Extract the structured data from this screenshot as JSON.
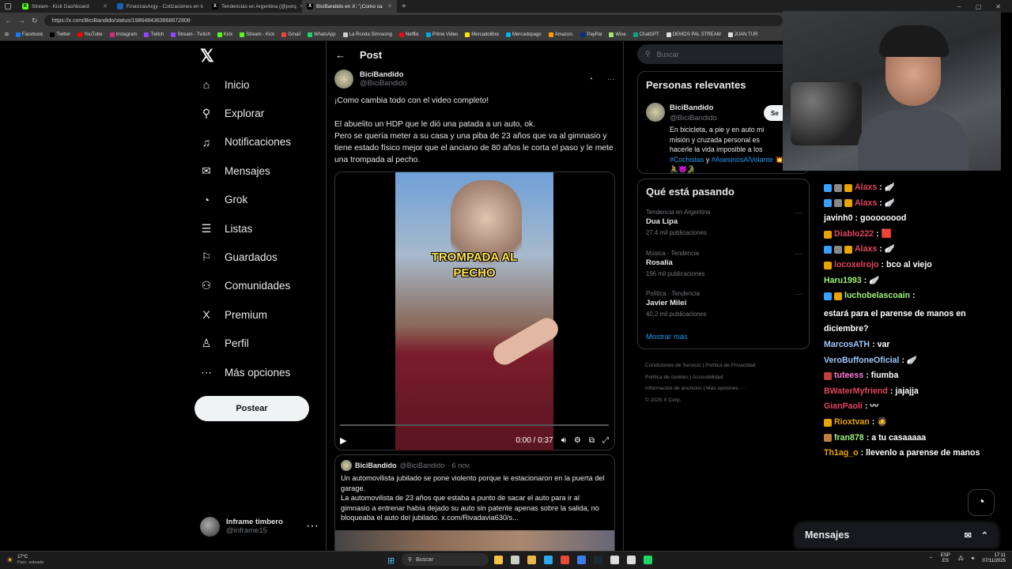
{
  "browser": {
    "tabs": [
      {
        "label": "Stream - Kick Dashboard",
        "icon_color": "#53fc18",
        "icon_text": "K"
      },
      {
        "label": "FinanzasArgy - Cotizaciones en ti",
        "icon_color": "#1a5fb4",
        "icon_text": ""
      },
      {
        "label": "Tendencias en Argentina (@porq",
        "icon_color": "#000000",
        "icon_text": "X"
      },
      {
        "label": "BiciBandido en X: \"¡Como ca",
        "icon_color": "#000000",
        "icon_text": "X"
      }
    ],
    "url": "https://x.com/BiciBandido/status/1986484363668672808",
    "bookmarks": [
      "Facebook",
      "Twitter",
      "YouTube",
      "Instagram",
      "Twitch",
      "Stream - Twitch",
      "Kick",
      "Stream - Kick",
      "Gmail",
      "WhatsApp",
      "La Ronda Simracing",
      "Netflix",
      "Prime Video",
      "Mercadolibre",
      "Mercadopago",
      "Amazon.",
      "PayPal",
      "Wise",
      "ChatGPT",
      "DEMOS PAL STREAM",
      "JUAN TUR"
    ]
  },
  "nav": {
    "items": [
      {
        "label": "Inicio",
        "icon": "home-icon",
        "glyph": "⌂"
      },
      {
        "label": "Explorar",
        "icon": "search-icon",
        "glyph": "⚲"
      },
      {
        "label": "Notificaciones",
        "icon": "bell-icon",
        "glyph": "♫"
      },
      {
        "label": "Mensajes",
        "icon": "mail-icon",
        "glyph": "✉"
      },
      {
        "label": "Grok",
        "icon": "grok-icon",
        "glyph": "◔"
      },
      {
        "label": "Listas",
        "icon": "list-icon",
        "glyph": "☰"
      },
      {
        "label": "Guardados",
        "icon": "bookmark-icon",
        "glyph": "⚐"
      },
      {
        "label": "Comunidades",
        "icon": "communities-icon",
        "glyph": "⚇"
      },
      {
        "label": "Premium",
        "icon": "x-icon",
        "glyph": "X"
      },
      {
        "label": "Perfil",
        "icon": "profile-icon",
        "glyph": "♙"
      },
      {
        "label": "Más opciones",
        "icon": "more-options-icon",
        "glyph": "⋯"
      }
    ],
    "post_button": "Postear",
    "account": {
      "name": "Inframe timbero",
      "handle": "@inframe15"
    }
  },
  "post": {
    "header": "Post",
    "author_name": "BiciBandido",
    "author_handle": "@BiciBandido",
    "text_1": "¡Como cambia todo con el video completo!",
    "text_2": "El abuelito un HDP que le dió una patada a un auto, ok.",
    "text_3": "Pero se quería meter a su casa y una piba de 23 años que va al gimnasio y tiene estado físico mejor que el anciano de 80 años le corta el paso y le mete una trompada al pecho.",
    "video_caption_1": "TROMPADA AL",
    "video_caption_2": "PECHO",
    "video_time": "0:00 / 0:37",
    "video_progress": 0,
    "quote": {
      "name": "BiciBandido",
      "handle": "@BiciBandido",
      "date": "· 6 nov.",
      "text_1": "Un automovilista jubilado se pone violento porque le estacionaron en la puerta del garage.",
      "text_2": "La automovilista de 23 años que estaba a punto de sacar el auto para ir al gimnasio a entrenar había dejado su auto sin patente apenas sobre la salida, no bloqueaba el auto del jubilado. x.com/Rivadavia630/s..."
    }
  },
  "sidebar": {
    "search_placeholder": "Buscar",
    "relevant_title": "Personas relevantes",
    "relevant": {
      "name": "BiciBandido",
      "handle": "@BiciBandido",
      "bio": "En bicicleta, a pie y en auto mi misión y cruzada personal es hacerle la vida imposible a los",
      "tag_1": "#Cochistas",
      "and": "y",
      "tag_2": "#AsesinosAlVolante",
      "emoji": "💥🚴😈🐊",
      "follow": "Se"
    },
    "trends_title": "Qué está pasando",
    "trends": [
      {
        "meta": "Tendencia en Argentina",
        "name": "Dua Lipa",
        "count": "27,4 mil publicaciones"
      },
      {
        "meta": "Música · Tendencia",
        "name": "Rosalía",
        "count": "196 mil publicaciones"
      },
      {
        "meta": "Política · Tendencia",
        "name": "Javier Milei",
        "count": "40,2 mil publicaciones"
      }
    ],
    "show_more": "Mostrar más",
    "footer": [
      "Condiciones de Servicio",
      "Política de Privacidad",
      "Política de cookies",
      "Accesibilidad",
      "Información de anuncios",
      "Más opciones ···",
      "© 2025 X Corp."
    ]
  },
  "chat": {
    "messages": [
      {
        "user": "Alaxs",
        "color": "#e0455f",
        "msg": "🪽",
        "badges": [
          "#3aa0ff",
          "#888",
          "#e8a400"
        ]
      },
      {
        "user": "Alaxs",
        "color": "#e0455f",
        "msg": "🪽",
        "badges": [
          "#3aa0ff",
          "#888",
          "#e8a400"
        ]
      },
      {
        "user": "javinh0",
        "color": "#ffffff",
        "msg": "goooooood",
        "badges": []
      },
      {
        "user": "Diablo222",
        "color": "#e0455f",
        "msg": "🟥",
        "badges": [
          "#e8a400"
        ]
      },
      {
        "user": "Alaxs",
        "color": "#e0455f",
        "msg": "🪽",
        "badges": [
          "#3aa0ff",
          "#888",
          "#e8a400"
        ]
      },
      {
        "user": "locoxelrojo",
        "color": "#e0455f",
        "msg": "bco al viejo",
        "badges": [
          "#e8a400"
        ]
      },
      {
        "user": "Haru1993",
        "color": "#9ef37a",
        "msg": "🪽",
        "badges": []
      },
      {
        "user": "luchobelascoain",
        "color": "#9ef37a",
        "msg": "estará para el parense de manos en diciembre?",
        "badges": [
          "#3aa0ff",
          "#e8a400"
        ]
      },
      {
        "user": "MarcosATH",
        "color": "#9fc8ff",
        "msg": "var",
        "badges": []
      },
      {
        "user": "VeroBuffoneOficial",
        "color": "#9fc8ff",
        "msg": "🪽",
        "badges": []
      },
      {
        "user": "tuteess",
        "color": "#ff7ad9",
        "msg": "fiumba",
        "badges": [
          "#c04040"
        ]
      },
      {
        "user": "BWaterMyfriend",
        "color": "#e0455f",
        "msg": "jajajja",
        "badges": []
      },
      {
        "user": "GianPaoli",
        "color": "#e0455f",
        "msg": "〰",
        "badges": []
      },
      {
        "user": "Rioxtvan",
        "color": "#e8a400",
        "msg": "🧔",
        "badges": [
          "#e8a400"
        ]
      },
      {
        "user": "fran878",
        "color": "#9ef37a",
        "msg": "a tu casaaaaa",
        "badges": [
          "#c08040"
        ]
      },
      {
        "user": "Th1ag_o",
        "color": "#e8a400",
        "msg": "llevenlo a parense de manos",
        "badges": []
      }
    ],
    "messages_panel": "Mensajes"
  },
  "taskbar": {
    "weather_temp": "17°C",
    "weather_desc": "Parc. soleado",
    "search": "Buscar",
    "lang_1": "ESP",
    "lang_2": "ES",
    "time": "17:11",
    "date": "07/11/2025"
  },
  "colors": {
    "accent": "#1d9bf0",
    "bg": "#000000",
    "border": "#2f3336"
  }
}
